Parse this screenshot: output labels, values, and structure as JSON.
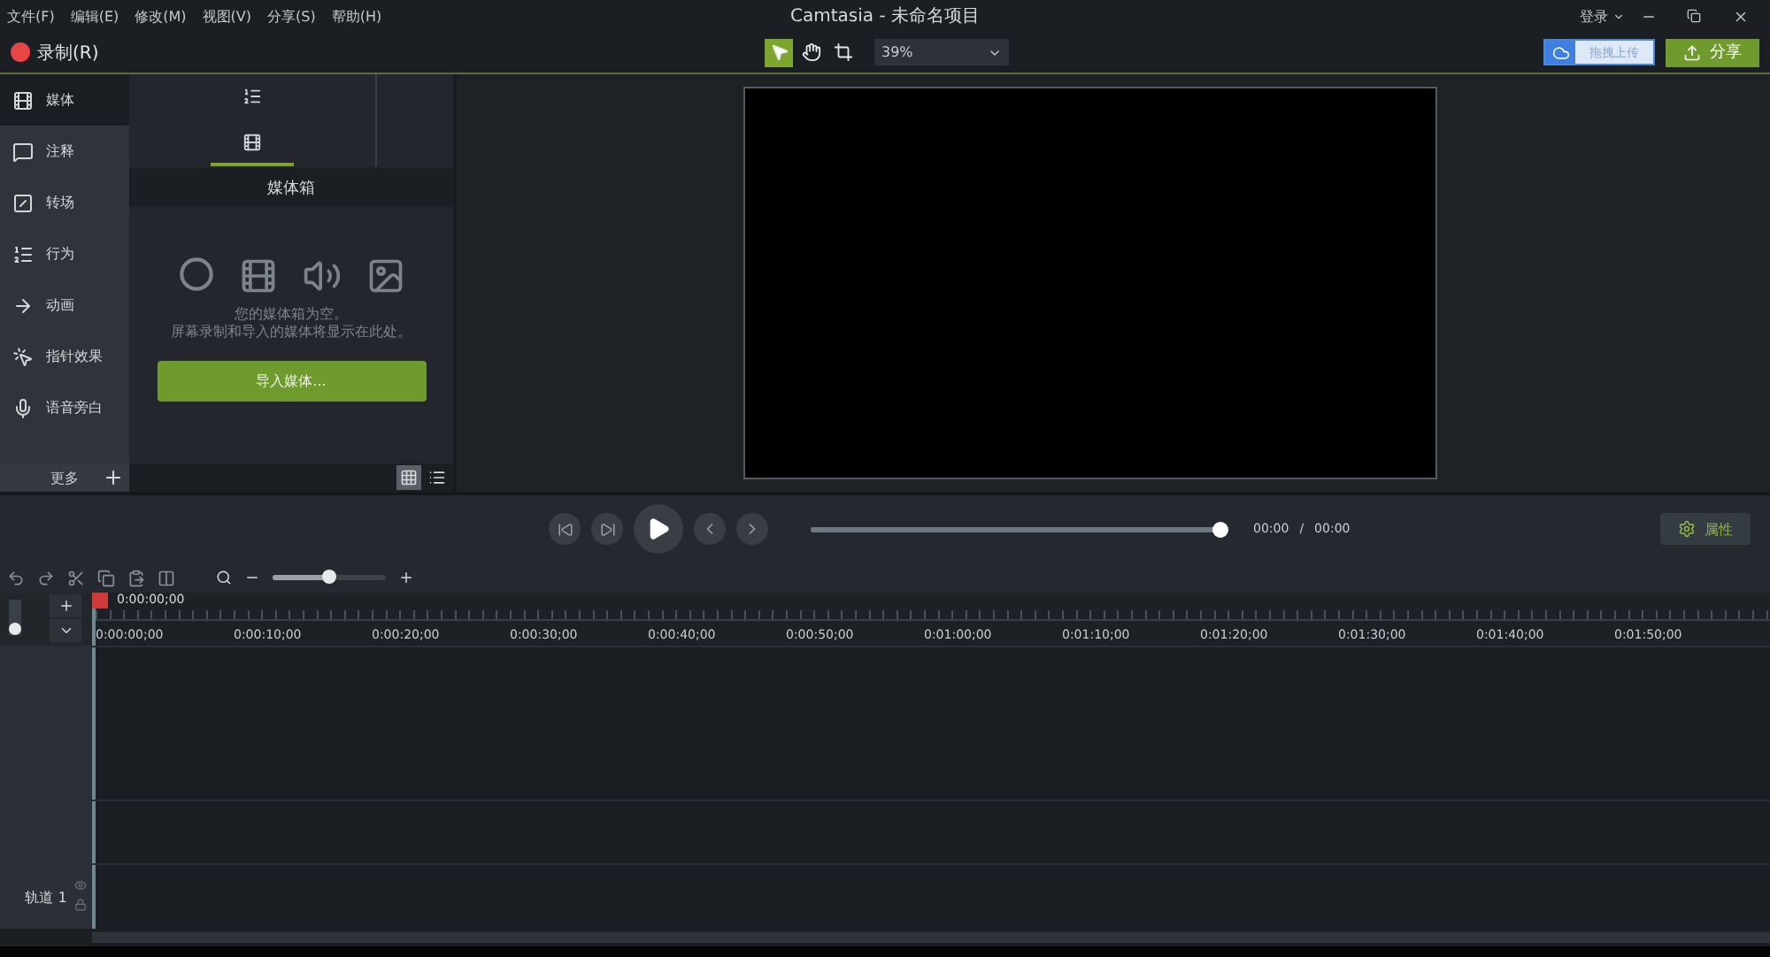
{
  "menu": [
    "文件(F)",
    "编辑(E)",
    "修改(M)",
    "视图(V)",
    "分享(S)",
    "帮助(H)"
  ],
  "window": {
    "title": "Camtasia - 未命名项目",
    "login": "登录"
  },
  "toolbar": {
    "record": "录制(R)",
    "tools": [
      {
        "kind": "select",
        "selected": true
      },
      {
        "kind": "hand",
        "selected": false
      },
      {
        "kind": "crop",
        "selected": false
      }
    ],
    "zoom": "39%",
    "upload": "拖拽上传",
    "share": "分享"
  },
  "sidebar": {
    "items": [
      {
        "kind": "media",
        "label": "媒体",
        "selected": true
      },
      {
        "kind": "annotation",
        "label": "注释",
        "selected": false
      },
      {
        "kind": "transition",
        "label": "转场",
        "selected": false
      },
      {
        "kind": "behavior",
        "label": "行为",
        "selected": false
      },
      {
        "kind": "animation",
        "label": "动画",
        "selected": false
      },
      {
        "kind": "cursor",
        "label": "指针效果",
        "selected": false
      },
      {
        "kind": "voice",
        "label": "语音旁白",
        "selected": false
      }
    ],
    "more": "更多"
  },
  "media_panel": {
    "tabs": [
      {
        "kind": "list",
        "selected": false
      },
      {
        "kind": "bin",
        "selected": true
      }
    ],
    "title": "媒体箱",
    "empty_lines": [
      "您的媒体箱为空。",
      "屏幕录制和导入的媒体将显示在此处。"
    ],
    "import": "导入媒体...",
    "views": [
      {
        "kind": "grid",
        "selected": true
      },
      {
        "kind": "list",
        "selected": false
      }
    ]
  },
  "playback": {
    "level": 1,
    "current": "00:00",
    "separator": "/",
    "total": "00:00",
    "properties": "属性"
  },
  "timeline": {
    "playhead": "0:00:00;00",
    "ticks": [
      "0:00:00;00",
      "0:00:10;00",
      "0:00:20;00",
      "0:00:30;00",
      "0:00:40;00",
      "0:00:50;00",
      "0:01:00;00",
      "0:01:10;00",
      "0:01:20;00",
      "0:01:30;00",
      "0:01:40;00",
      "0:01:50;00"
    ],
    "tracks": [
      {
        "label": "轨道 1"
      }
    ]
  }
}
